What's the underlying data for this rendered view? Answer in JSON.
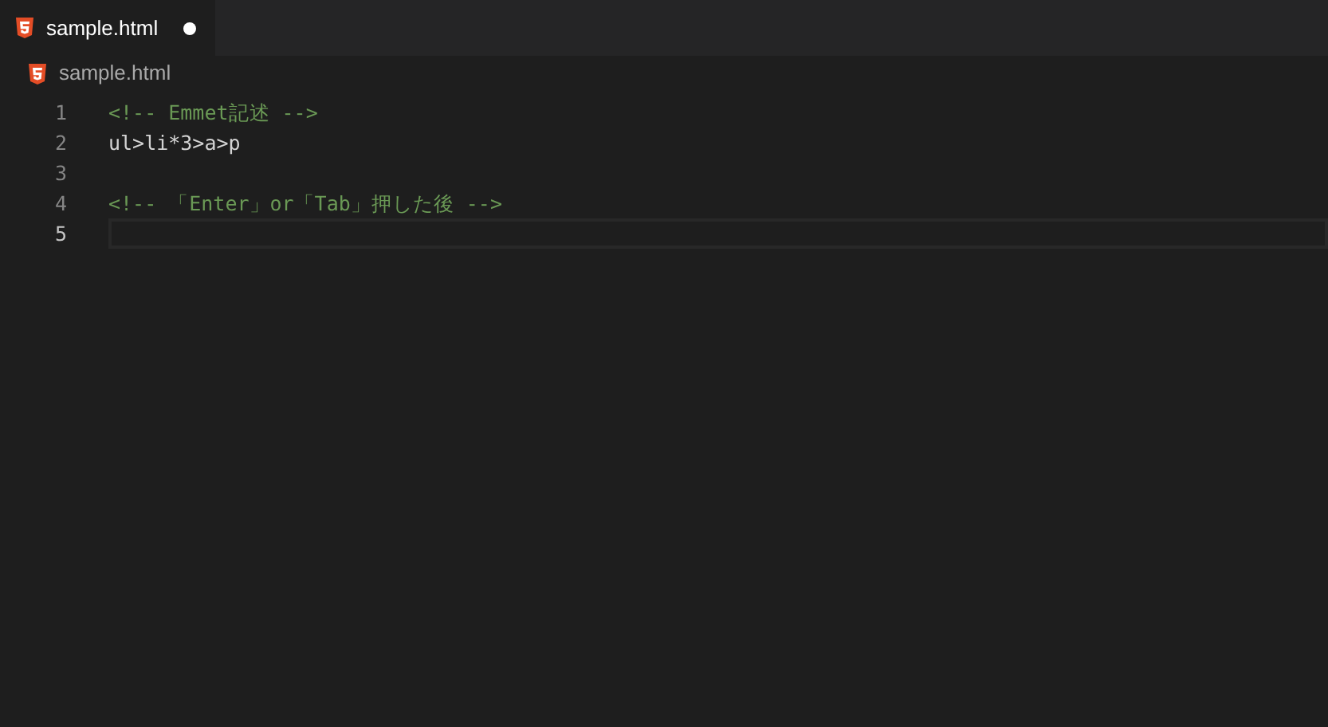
{
  "tabs": [
    {
      "label": "sample.html",
      "selected": true,
      "modified": true
    }
  ],
  "breadcrumb": {
    "label": "sample.html"
  },
  "editor": {
    "lines": [
      {
        "number": "1",
        "text": "<!-- Emmet記述 -->",
        "kind": "comment",
        "current": false
      },
      {
        "number": "2",
        "text": "ul>li*3>a>p",
        "kind": "code",
        "current": false
      },
      {
        "number": "3",
        "kind": "code",
        "current": false
      },
      {
        "number": "4",
        "text": "<!-- 「Enter」or「Tab」押した後 -->",
        "kind": "comment",
        "current": false
      },
      {
        "number": "5",
        "kind": "code",
        "current": true
      }
    ]
  }
}
